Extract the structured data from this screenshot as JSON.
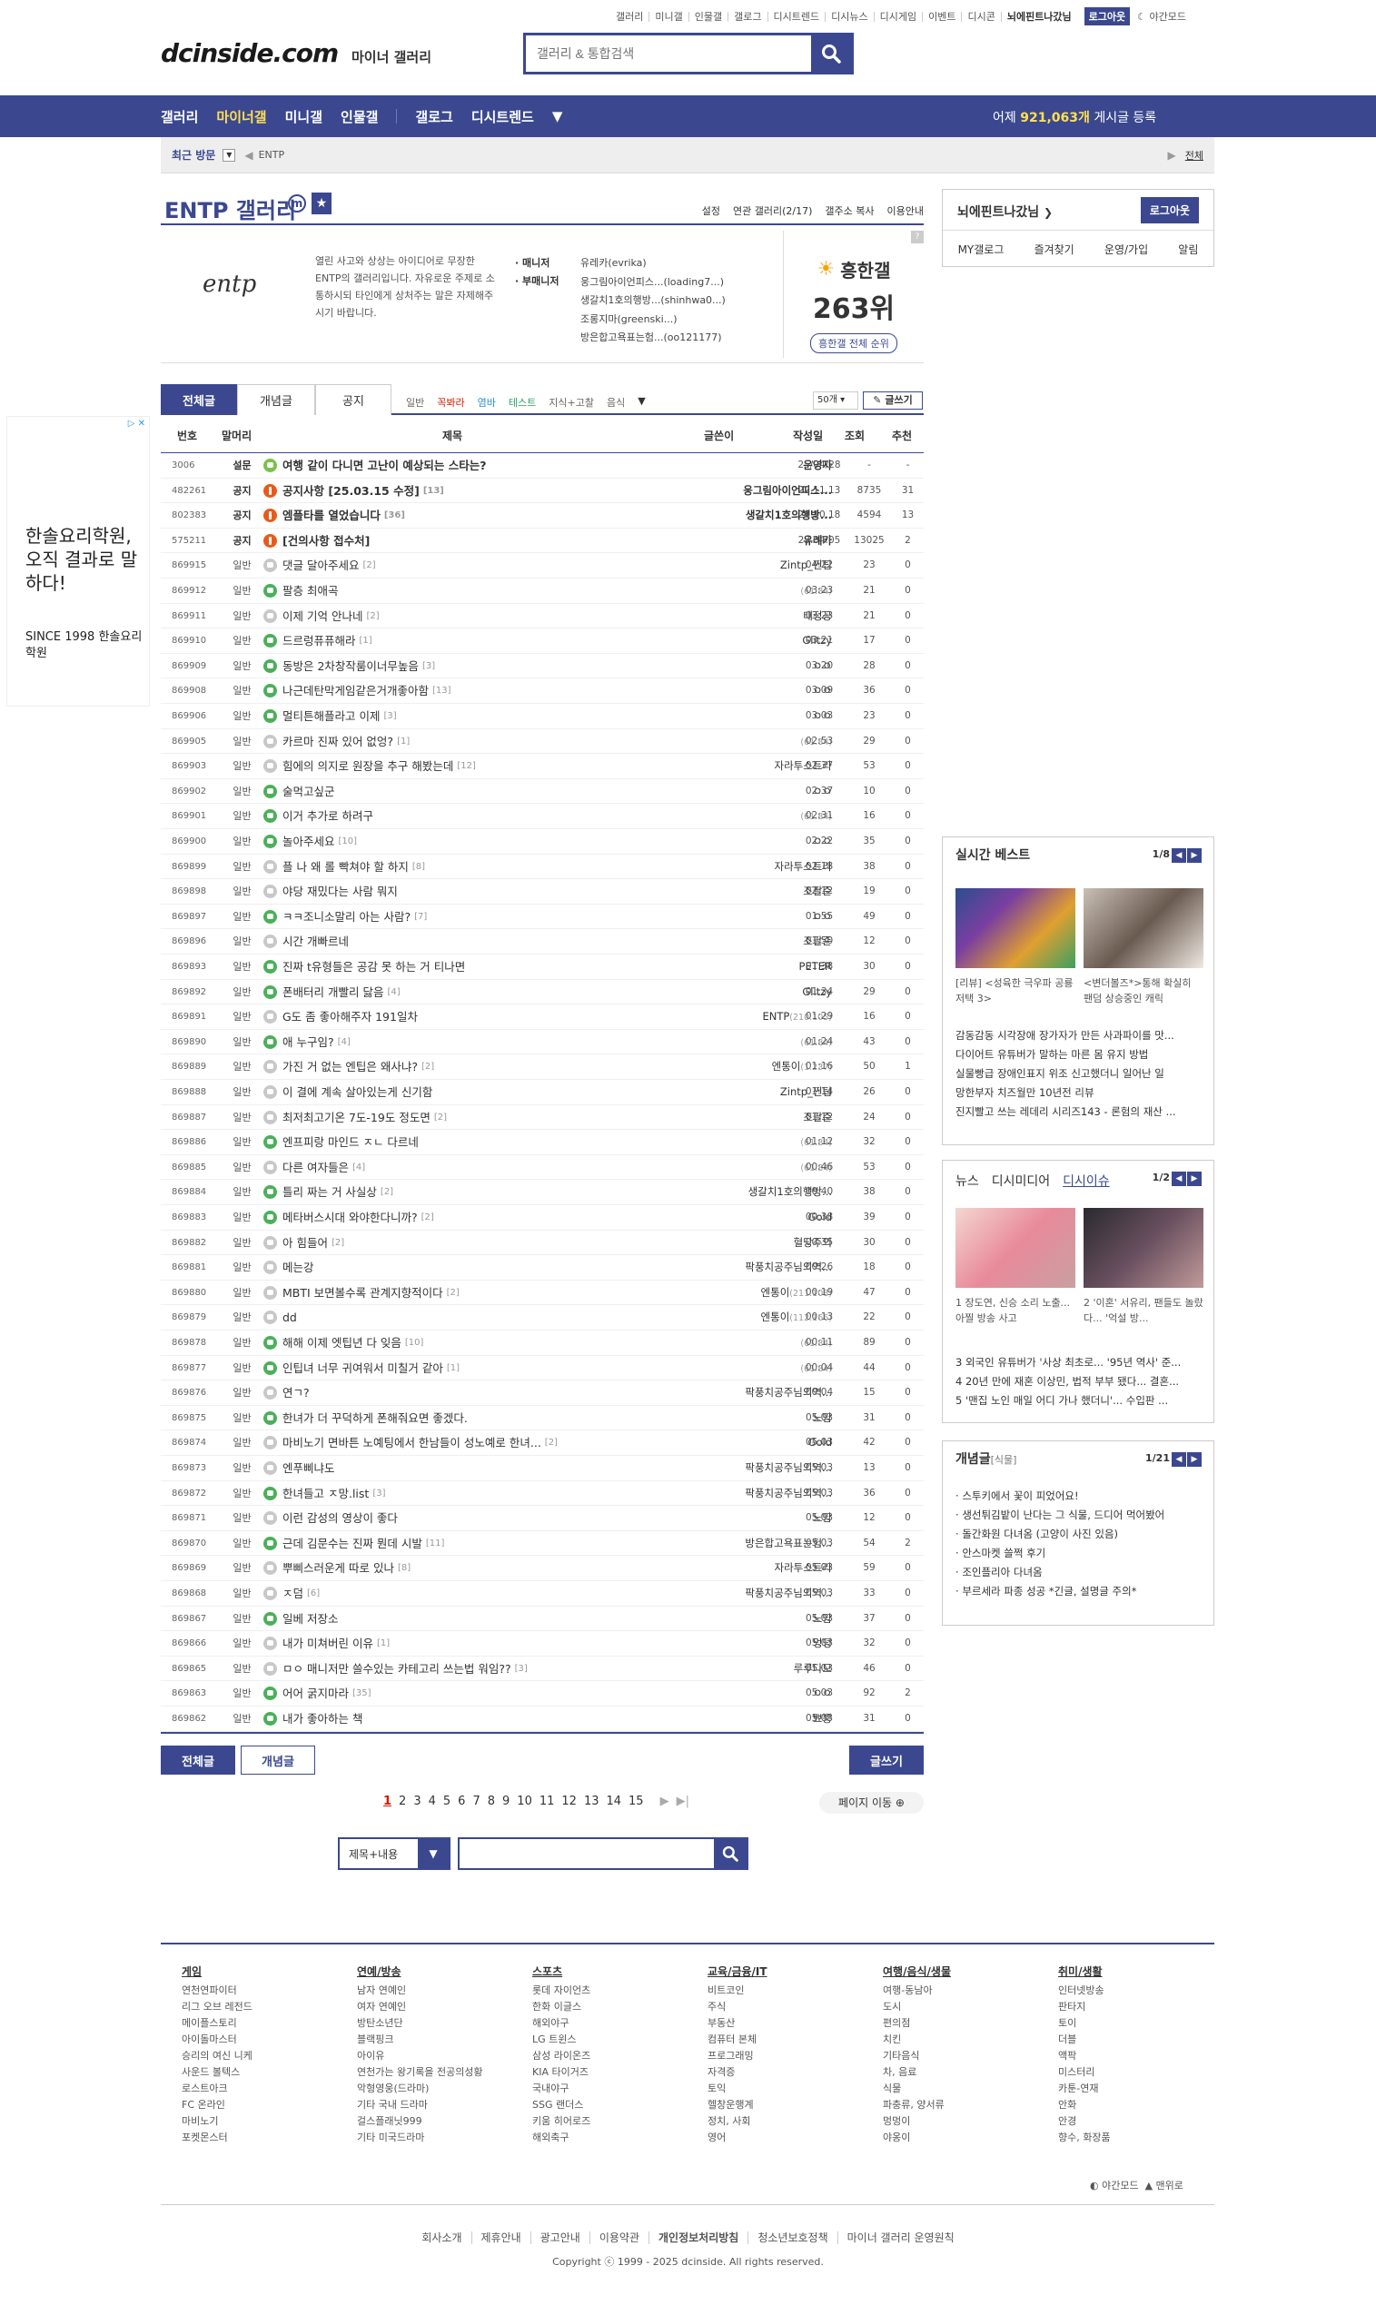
{
  "header": {
    "util_links": [
      "갤러리",
      "미니갤",
      "인물갤",
      "갤로그",
      "디시트렌드",
      "디시뉴스",
      "디시게임",
      "이벤트",
      "디시콘"
    ],
    "nickname": "뇌에핀트나갔님",
    "logout": "로그아웃",
    "night": "야간모드",
    "logo": "dcinside.com",
    "logo_sub": "마이너 갤러리",
    "search_placeholder": "갤러리 & 통합검색"
  },
  "gnb": {
    "items": [
      "갤러리",
      "마이너갤",
      "미니갤",
      "인물갤"
    ],
    "items2": [
      "갤로그",
      "디시트렌드"
    ],
    "stat_prefix": "어제",
    "stat_count": "921,063개",
    "stat_suffix": "게시글 등록"
  },
  "visit": {
    "label": "최근 방문",
    "item": "ENTP",
    "all": "전체"
  },
  "gallery": {
    "title": "ENTP 갤러리",
    "links": [
      "설정",
      "연관 갤러리(2/17)",
      "갤주소 복사",
      "이용안내"
    ],
    "desc": "열린 사고와 상상는 아이디어로 무장한 ENTP의 갤러리입니다. 자유로운 주제로 소통하시되 타인에게 상처주는 말은 자제해주시기 바랍니다.",
    "manager_label": "매니저",
    "submanager_label": "부매니저",
    "manager": "유레카(evrika)",
    "submanagers": [
      "웅그림아이언피스...(loading7...)",
      "생갈치1호의행방...(shinhwa0...)",
      "조롱지마(greenski...)",
      "방은합고욕표는험...(oo121177)"
    ],
    "logo_text": "entp",
    "rank_label": "흥한갤",
    "rank": "263위",
    "rank_btn": "흥한갤 전체 순위"
  },
  "login_box": {
    "nick": "뇌에핀트나갔님",
    "logout": "로그아웃",
    "links": [
      "MY갤로그",
      "즐겨찾기",
      "운영/가입",
      "알림"
    ]
  },
  "tabs": {
    "items": [
      "전체글",
      "개념글",
      "공지"
    ],
    "heads": [
      "일반",
      "꼭봐라",
      "염바",
      "테스트",
      "지식+고찰",
      "음식"
    ],
    "count": "50개",
    "write": "글쓰기"
  },
  "columns": [
    "번호",
    "말머리",
    "제목",
    "글쓴이",
    "작성일",
    "조회",
    "추천"
  ],
  "rows": [
    {
      "no": "3006",
      "head": "설문",
      "title": "여행 같이 다니면 고난이 예상되는 스타는?",
      "cnt": "",
      "writer": "운영자",
      "ip": "",
      "date": "25/04/28",
      "view": "-",
      "rec": "-",
      "icon": "lg",
      "notice": true
    },
    {
      "no": "482261",
      "head": "공지",
      "title": "공지사항 [25.03.15 수정]",
      "cnt": "[13]",
      "writer": "웅그림아이언피스...",
      "ip": "",
      "date": "22.11.13",
      "view": "8735",
      "rec": "31",
      "icon": "o",
      "notice": true
    },
    {
      "no": "802383",
      "head": "공지",
      "title": "엠플타를 열었습니다",
      "cnt": "[36]",
      "writer": "생갈치1호의행방...",
      "ip": "",
      "date": "24.10.18",
      "view": "4594",
      "rec": "13",
      "icon": "o",
      "notice": true
    },
    {
      "no": "575211",
      "head": "공지",
      "title": "[건의사항 접수처]",
      "cnt": "",
      "writer": "유레카",
      "ip": "",
      "date": "23.04.05",
      "view": "13025",
      "rec": "2",
      "icon": "o",
      "notice": true
    },
    {
      "no": "869915",
      "head": "일반",
      "title": "댓글 달아주세요",
      "cnt": "[2]",
      "writer": "Zintp_찐팁",
      "ip": "",
      "date": "04:22",
      "view": "23",
      "rec": "0",
      "icon": "gr"
    },
    {
      "no": "869912",
      "head": "일반",
      "title": "팔층 최애곡",
      "cnt": "",
      "writer": "",
      "ip": "(61.84)",
      "date": "03:23",
      "view": "21",
      "rec": "0",
      "icon": "g"
    },
    {
      "no": "869911",
      "head": "일반",
      "title": "이제 기억 안나네",
      "cnt": "[2]",
      "writer": "태정공",
      "ip": "",
      "date": "03:23",
      "view": "21",
      "rec": "0",
      "icon": "gr"
    },
    {
      "no": "869910",
      "head": "일반",
      "title": "드르렁퓨퓨해라",
      "cnt": "[1]",
      "writer": "Glitzy",
      "ip": "",
      "date": "03:21",
      "view": "17",
      "rec": "0",
      "icon": "g"
    },
    {
      "no": "869909",
      "head": "일반",
      "title": "동방은 2차창작룸이너무높음",
      "cnt": "[3]",
      "writer": "ㅇㅇ",
      "ip": "",
      "date": "03:20",
      "view": "28",
      "rec": "0",
      "icon": "g"
    },
    {
      "no": "869908",
      "head": "일반",
      "title": "나근데탄막게임같은거개좋아함",
      "cnt": "[13]",
      "writer": "ㅇㅇ",
      "ip": "",
      "date": "03:09",
      "view": "36",
      "rec": "0",
      "icon": "g"
    },
    {
      "no": "869906",
      "head": "일반",
      "title": "멀티튼해플라고 이제",
      "cnt": "[3]",
      "writer": "ㅇㅇ",
      "ip": "",
      "date": "03:03",
      "view": "23",
      "rec": "0",
      "icon": "g"
    },
    {
      "no": "869905",
      "head": "일반",
      "title": "카르마 진짜 있어 없엉?",
      "cnt": "[1]",
      "writer": "",
      "ip": "(61.84)",
      "date": "02:53",
      "view": "29",
      "rec": "0",
      "icon": "gr"
    },
    {
      "no": "869903",
      "head": "일반",
      "title": "힘에의 의지로 원장을 추구 해봤는데",
      "cnt": "[12]",
      "writer": "자라투스트라",
      "ip": "",
      "date": "02:37",
      "view": "53",
      "rec": "0",
      "icon": "gr"
    },
    {
      "no": "869902",
      "head": "일반",
      "title": "술먹고싶군",
      "cnt": "",
      "writer": "ㅇㅇ",
      "ip": "",
      "date": "02:37",
      "view": "10",
      "rec": "0",
      "icon": "g"
    },
    {
      "no": "869901",
      "head": "일반",
      "title": "이거 추가로 하려구",
      "cnt": "",
      "writer": "",
      "ip": "(61.84)",
      "date": "02:31",
      "view": "16",
      "rec": "0",
      "icon": "g"
    },
    {
      "no": "869900",
      "head": "일반",
      "title": "놀아주세요",
      "cnt": "[10]",
      "writer": "ㅇㅇ",
      "ip": "",
      "date": "02:22",
      "view": "35",
      "rec": "0",
      "icon": "g"
    },
    {
      "no": "869899",
      "head": "일반",
      "title": "플 나 왜 롤 빡쳐야 할 하지",
      "cnt": "[8]",
      "writer": "자라투스트라",
      "ip": "",
      "date": "02:18",
      "view": "38",
      "rec": "0",
      "icon": "gr"
    },
    {
      "no": "869898",
      "head": "일반",
      "title": "야당 재밌다는 사람 뭐지",
      "cnt": "",
      "writer": "조팔준",
      "ip": "",
      "date": "02:12",
      "view": "19",
      "rec": "0",
      "icon": "gr"
    },
    {
      "no": "869897",
      "head": "일반",
      "title": "ㅋㅋ조니소말리 아는 사람?",
      "cnt": "[7]",
      "writer": "ㅇㅇ",
      "ip": "",
      "date": "01:55",
      "view": "49",
      "rec": "0",
      "icon": "g"
    },
    {
      "no": "869896",
      "head": "일반",
      "title": "시간 개빠르네",
      "cnt": "",
      "writer": "조팔준",
      "ip": "",
      "date": "01:50",
      "view": "12",
      "rec": "0",
      "icon": "gr"
    },
    {
      "no": "869893",
      "head": "일반",
      "title": "진짜 t유형들은 공감 못 하는 거 티나면",
      "cnt": "",
      "writer": "PETER",
      "ip": "",
      "date": "01:38",
      "view": "30",
      "rec": "0",
      "icon": "g"
    },
    {
      "no": "869892",
      "head": "일반",
      "title": "폰배터리 개빨리 닳음",
      "cnt": "[4]",
      "writer": "Glitzy",
      "ip": "",
      "date": "01:34",
      "view": "29",
      "rec": "0",
      "icon": "g"
    },
    {
      "no": "869891",
      "head": "일반",
      "title": "G도 좀 좋아해주자 191일차",
      "cnt": "",
      "writer": "ENTP",
      "ip": "(210.105)",
      "date": "01:29",
      "view": "16",
      "rec": "0",
      "icon": "gr"
    },
    {
      "no": "869890",
      "head": "일반",
      "title": "애 누구임?",
      "cnt": "[4]",
      "writer": "",
      "ip": "(61.84)",
      "date": "01:24",
      "view": "43",
      "rec": "0",
      "icon": "g"
    },
    {
      "no": "869889",
      "head": "일반",
      "title": "가진 거 없는 엔팁은 왜사냐?",
      "cnt": "[2]",
      "writer": "엔통이",
      "ip": "(1.237)",
      "date": "01:16",
      "view": "50",
      "rec": "1",
      "icon": "gr"
    },
    {
      "no": "869888",
      "head": "일반",
      "title": "이 결에 계속 살아있는게 신기함",
      "cnt": "",
      "writer": "Zintp_찐팁",
      "ip": "",
      "date": "01:14",
      "view": "26",
      "rec": "0",
      "icon": "gr"
    },
    {
      "no": "869887",
      "head": "일반",
      "title": "최저최고기온 7도-19도 정도면",
      "cnt": "[2]",
      "writer": "조팔준",
      "ip": "",
      "date": "01:12",
      "view": "24",
      "rec": "0",
      "icon": "gr"
    },
    {
      "no": "869886",
      "head": "일반",
      "title": "엔프피랑 마인드 ㅈㄴ 다르네",
      "cnt": "",
      "writer": "",
      "ip": "(61.84)",
      "date": "01:12",
      "view": "32",
      "rec": "0",
      "icon": "g"
    },
    {
      "no": "869885",
      "head": "일반",
      "title": "다른 여자들은",
      "cnt": "[4]",
      "writer": "",
      "ip": "(61.84)",
      "date": "00:46",
      "view": "53",
      "rec": "0",
      "icon": "gr"
    },
    {
      "no": "869884",
      "head": "일반",
      "title": "틀리 짜는 거 사실상",
      "cnt": "[2]",
      "writer": "생갈치1호의행방...",
      "ip": "",
      "date": "00:40",
      "view": "38",
      "rec": "0",
      "icon": "g"
    },
    {
      "no": "869883",
      "head": "일반",
      "title": "메타버스시대 와야한다니까?",
      "cnt": "[2]",
      "writer": "Gold",
      "ip": "",
      "date": "00:38",
      "view": "39",
      "rec": "0",
      "icon": "g"
    },
    {
      "no": "869882",
      "head": "일반",
      "title": "아 힘들어",
      "cnt": "[2]",
      "writer": "혈당주의",
      "ip": "",
      "date": "00:35",
      "view": "30",
      "rec": "0",
      "icon": "gr"
    },
    {
      "no": "869881",
      "head": "일반",
      "title": "메는강",
      "cnt": "",
      "writer": "팍풍치공주님의역...",
      "ip": "",
      "date": "00:26",
      "view": "18",
      "rec": "0",
      "icon": "gr"
    },
    {
      "no": "869880",
      "head": "일반",
      "title": "MBTI 보면볼수록 관계지향적이다",
      "cnt": "[2]",
      "writer": "엔통이",
      "ip": "(211.108)",
      "date": "00:19",
      "view": "47",
      "rec": "0",
      "icon": "gr"
    },
    {
      "no": "869879",
      "head": "일반",
      "title": "dd",
      "cnt": "",
      "writer": "엔통이",
      "ip": "(112.166)",
      "date": "00:13",
      "view": "22",
      "rec": "0",
      "icon": "gr"
    },
    {
      "no": "869878",
      "head": "일반",
      "title": "해해 이제 엣팁년 다 잊음",
      "cnt": "[10]",
      "writer": "",
      "ip": "(61.84)",
      "date": "00:11",
      "view": "89",
      "rec": "0",
      "icon": "g"
    },
    {
      "no": "869877",
      "head": "일반",
      "title": "인팁녀 너무 귀여워서 미칠거 같아",
      "cnt": "[1]",
      "writer": "",
      "ip": "(61.84)",
      "date": "00:04",
      "view": "44",
      "rec": "0",
      "icon": "g"
    },
    {
      "no": "869876",
      "head": "일반",
      "title": "연ㄱ?",
      "cnt": "",
      "writer": "팍풍치공주님의역...",
      "ip": "",
      "date": "00:04",
      "view": "15",
      "rec": "0",
      "icon": "gr"
    },
    {
      "no": "869875",
      "head": "일반",
      "title": "한녀가 더 꾸덕하게 폰해줘요면 좋겠다.",
      "cnt": "",
      "writer": "노맘",
      "ip": "",
      "date": "05.03",
      "view": "31",
      "rec": "0",
      "icon": "g"
    },
    {
      "no": "869874",
      "head": "일반",
      "title": "마비노기 면바튼 노예팅에서 한남들이 성노예로 한녀...",
      "cnt": "[2]",
      "writer": "Gold",
      "ip": "",
      "date": "05.03",
      "view": "42",
      "rec": "0",
      "icon": "gr"
    },
    {
      "no": "869873",
      "head": "일반",
      "title": "엔푸삐냐도",
      "cnt": "",
      "writer": "팍풍치공주님의역...",
      "ip": "",
      "date": "05.03",
      "view": "13",
      "rec": "0",
      "icon": "gr"
    },
    {
      "no": "869872",
      "head": "일반",
      "title": "한녀들고 ㅈ망.list",
      "cnt": "[3]",
      "writer": "팍풍치공주님의역...",
      "ip": "",
      "date": "05.03",
      "view": "36",
      "rec": "0",
      "icon": "g"
    },
    {
      "no": "869871",
      "head": "일반",
      "title": "이런 감성의 영상이 좋다",
      "cnt": "",
      "writer": "노맘",
      "ip": "",
      "date": "05.03",
      "view": "12",
      "rec": "0",
      "icon": "gr"
    },
    {
      "no": "869870",
      "head": "일반",
      "title": "근데 김문수는 진짜 뭔데 시발",
      "cnt": "[11]",
      "writer": "방은합고욕표는험...",
      "ip": "",
      "date": "05.03",
      "view": "54",
      "rec": "2",
      "icon": "g"
    },
    {
      "no": "869869",
      "head": "일반",
      "title": "뿌삐스러운게 따로 있나",
      "cnt": "[8]",
      "writer": "자라투스트라",
      "ip": "",
      "date": "05.03",
      "view": "59",
      "rec": "0",
      "icon": "gr"
    },
    {
      "no": "869868",
      "head": "일반",
      "title": "ㅈ덤",
      "cnt": "[6]",
      "writer": "팍풍치공주님의역...",
      "ip": "",
      "date": "05.03",
      "view": "33",
      "rec": "0",
      "icon": "gr"
    },
    {
      "no": "869867",
      "head": "일반",
      "title": "일베 저장소",
      "cnt": "",
      "writer": "노맘",
      "ip": "",
      "date": "05.03",
      "view": "37",
      "rec": "0",
      "icon": "g"
    },
    {
      "no": "869866",
      "head": "일반",
      "title": "내가 미쳐버린 이유",
      "cnt": "[1]",
      "writer": "멍덩",
      "ip": "",
      "date": "05.03",
      "view": "32",
      "rec": "0",
      "icon": "gr"
    },
    {
      "no": "869865",
      "head": "일반",
      "title": "ㅁㅇ 매니저만 쓸수있는 카테고리 쓰는법 워임??",
      "cnt": "[3]",
      "writer": "루루다모",
      "ip": "",
      "date": "05.03",
      "view": "46",
      "rec": "0",
      "icon": "gr"
    },
    {
      "no": "869863",
      "head": "일반",
      "title": "어어 굵지마라",
      "cnt": "[35]",
      "writer": "ㅇㅇ",
      "ip": "",
      "date": "05.03",
      "view": "92",
      "rec": "2",
      "icon": "g"
    },
    {
      "no": "869862",
      "head": "일반",
      "title": "내가 좋아하는 책",
      "cnt": "",
      "writer": "뾰뿡",
      "ip": "",
      "date": "05.03",
      "view": "31",
      "rec": "0",
      "icon": "g"
    }
  ],
  "bottom": {
    "all": "전체글",
    "concept": "개념글",
    "write": "글쓰기",
    "pages": [
      "1",
      "2",
      "3",
      "4",
      "5",
      "6",
      "7",
      "8",
      "9",
      "10",
      "11",
      "12",
      "13",
      "14",
      "15"
    ],
    "page_move": "페이지 이동",
    "search_type": "제목+내용"
  },
  "ad": {
    "text": "한솔요리학원, 오직 결과로 말하다!",
    "sub": "SINCE 1998 한솔요리학원"
  },
  "best": {
    "title": "실시간 베스트",
    "page": "1/8",
    "items": [
      {
        "caption": "[리뷰] <성육한 극우파 공룡 저택 3>"
      },
      {
        "caption": "<변더볼즈*>통해 확실히 팬덤 상승중인 캐릭"
      }
    ],
    "list": [
      "감동감동 시각장애 장가자가 만든 사과파이를 맛...",
      "다이어트 유튜버가 말하는 마른 몸 유지 방법",
      "실물빵급 장애인표지 위조 신고했더니 일어난 일",
      "망한부자 치즈월만 10년전 리뷰",
      "진지빨고 쓰는 레데리 시리즈143 - 론험의 재산 ..."
    ]
  },
  "news": {
    "tabs": [
      "뉴스",
      "디시미디어",
      "디시이슈"
    ],
    "page": "1/2",
    "items": [
      {
        "caption": "1 장도연, 신승 소리 노출... 아찔 방송 사고"
      },
      {
        "caption": "2 '이혼' 서유리, 팬들도 놀랐다... '억설 방..."
      }
    ],
    "list": [
      "3 외국인 유튜버가 '사상 최초로... '95년 역사' 준...",
      "4 20년 만에 재혼 이상민, 법적 부부 됐다... 결혼...",
      "5 '맨집 노인 매일 어디 가나 했더니'... 수입판 ..."
    ]
  },
  "concept": {
    "title": "개념글",
    "tag": "[식물]",
    "page": "1/21",
    "list": [
      "스투키에서 꽃이 피었어요!",
      "생선튀김밭이 난다는 그 식물, 드디어 먹어봤어",
      "돌간화원 다녀옴 (고양이 사진 있음)",
      "안스마켓 쓸쩍 후기",
      "조인플리아 다녀옴",
      "부르세라 파종 성공 *긴글, 설명글 주의*"
    ]
  },
  "footer": {
    "cols": [
      {
        "h": "게임",
        "items": [
          "연천연파이터",
          "리그 오브 레전드",
          "메이플스토리",
          "아이돌마스터",
          "승리의 여신 니케",
          "사운드 볼텍스",
          "로스트아크",
          "FC 온라인",
          "마비노기",
          "포켓몬스터"
        ]
      },
      {
        "h": "연예/방송",
        "items": [
          "남자 연예인",
          "여자 연예인",
          "방탄소년단",
          "블랙핑크",
          "아이유",
          "연천가는 왕기록을 전공의성황",
          "악형영웅(드라마)",
          "기타 국내 드라마",
          "걸스플래닛999",
          "기타 미국드라마"
        ]
      },
      {
        "h": "스포츠",
        "items": [
          "롯데 자이언츠",
          "한화 이글스",
          "해외야구",
          "LG 트윈스",
          "삼성 라이온즈",
          "KIA 타이거즈",
          "국내야구",
          "SSG 랜더스",
          "키움 히어로즈",
          "해외축구"
        ]
      },
      {
        "h": "교육/금융/IT",
        "items": [
          "비트코인",
          "주식",
          "부동산",
          "컴퓨터 본체",
          "프로그래밍",
          "자격증",
          "토익",
          "헬창운행계",
          "정치, 사회",
          "영어"
        ]
      },
      {
        "h": "여행/음식/생물",
        "items": [
          "여행-동남아",
          "도시",
          "편의점",
          "치킨",
          "기타음식",
          "차, 음료",
          "식물",
          "파충류, 양서류",
          "멍멍이",
          "야옹이"
        ]
      },
      {
        "h": "취미/생활",
        "items": [
          "인터넷방송",
          "판타지",
          "토이",
          "더블",
          "액팍",
          "미스터리",
          "카툰-연재",
          "안화",
          "안경",
          "향수, 화장품"
        ]
      }
    ],
    "night": "야간모드",
    "top": "맨위로",
    "links": [
      "회사소개",
      "제휴안내",
      "광고안내",
      "이용약관",
      "개인정보처리방침",
      "청소년보호정책",
      "마이너 갤러리 운영원칙"
    ],
    "copyright": "Copyright ⓒ 1999 - 2025 dcinside. All rights reserved."
  }
}
